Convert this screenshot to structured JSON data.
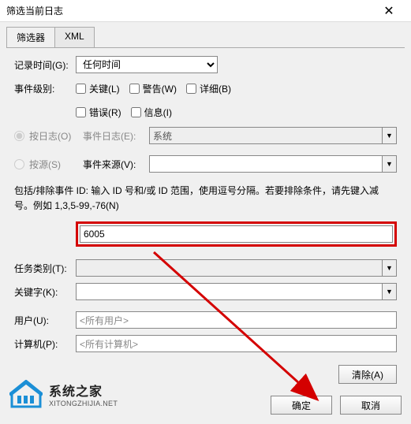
{
  "title": "筛选当前日志",
  "tabs": {
    "filter": "筛选器",
    "xml": "XML"
  },
  "labels": {
    "logged": "记录时间(G):",
    "level": "事件级别:",
    "byLog": "按日志(O)",
    "bySource": "按源(S)",
    "eventLog": "事件日志(E):",
    "eventSource": "事件来源(V):",
    "task": "任务类别(T):",
    "keyword": "关键字(K):",
    "user": "用户(U):",
    "computer": "计算机(P):"
  },
  "dropdowns": {
    "anytime": "任何时间",
    "system": "系统"
  },
  "checks": {
    "critical": "关键(L)",
    "warning": "警告(W)",
    "verbose": "详细(B)",
    "error": "错误(R)",
    "info": "信息(I)"
  },
  "instructions": "包括/排除事件 ID: 输入 ID 号和/或 ID 范围，使用逗号分隔。若要排除条件，请先键入减号。例如 1,3,5-99,-76(N)",
  "eventId": "6005",
  "user": "<所有用户>",
  "computer": "<所有计算机>",
  "buttons": {
    "clear": "清除(A)",
    "ok": "确定",
    "cancel": "取消"
  },
  "logo": {
    "cn": "系统之家",
    "en": "XITONGZHIJIA.NET"
  }
}
